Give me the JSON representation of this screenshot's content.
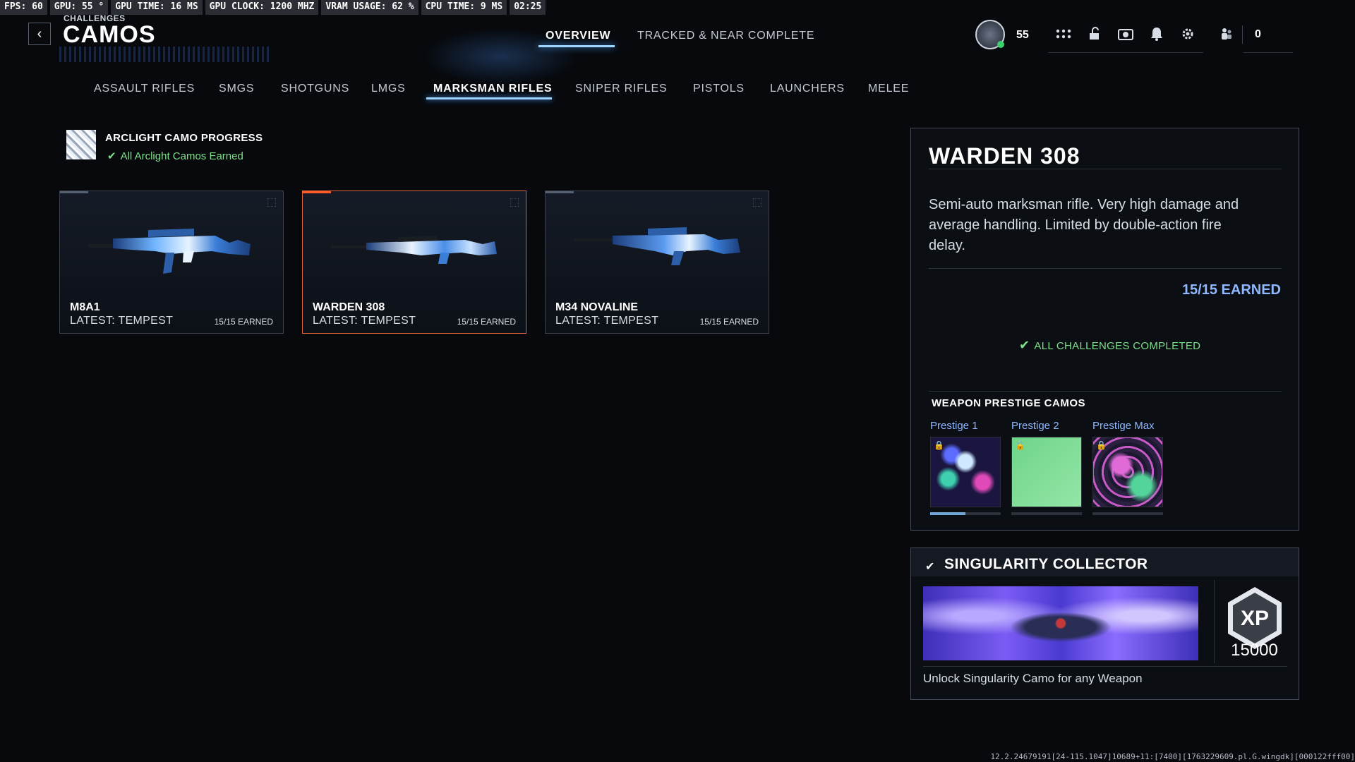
{
  "perf_overlay": [
    "FPS:  60",
    "GPU: 55 °",
    "GPU TIME: 16 MS",
    "GPU CLOCK: 1200 MHZ",
    "VRAM USAGE: 62 %",
    "CPU TIME:  9 MS",
    "02:25"
  ],
  "header": {
    "breadcrumb": "CHALLENGES",
    "title": "CAMOS",
    "tabs": [
      {
        "label": "OVERVIEW",
        "active": true
      },
      {
        "label": "TRACKED & NEAR COMPLETE",
        "active": false
      }
    ],
    "player_level": "55",
    "currency": "0",
    "icons": [
      "apps-grid-icon",
      "unlock-icon",
      "camera-icon",
      "bell-icon",
      "gear-icon",
      "friends-icon"
    ]
  },
  "categories": [
    {
      "label": "ASSAULT RIFLES",
      "active": false
    },
    {
      "label": "SMGS",
      "active": false
    },
    {
      "label": "SHOTGUNS",
      "active": false
    },
    {
      "label": "LMGS",
      "active": false
    },
    {
      "label": "MARKSMAN RIFLES",
      "active": true
    },
    {
      "label": "SNIPER RIFLES",
      "active": false
    },
    {
      "label": "PISTOLS",
      "active": false
    },
    {
      "label": "LAUNCHERS",
      "active": false
    },
    {
      "label": "MELEE",
      "active": false
    }
  ],
  "progress": {
    "title": "ARCLIGHT CAMO PROGRESS",
    "status": "All Arclight Camos Earned"
  },
  "weapons": [
    {
      "name": "M8A1",
      "latest": "LATEST: TEMPEST",
      "earned": "15/15 EARNED",
      "selected": false
    },
    {
      "name": "WARDEN 308",
      "latest": "LATEST: TEMPEST",
      "earned": "15/15 EARNED",
      "selected": true
    },
    {
      "name": "M34 NOVALINE",
      "latest": "LATEST: TEMPEST",
      "earned": "15/15 EARNED",
      "selected": false
    }
  ],
  "detail": {
    "weapon_name": "WARDEN 308",
    "description": "Semi-auto marksman rifle. Very high damage and average handling. Limited by double-action fire delay.",
    "earned": "15/15 EARNED",
    "status": "ALL CHALLENGES COMPLETED",
    "prestige_title": "WEAPON PRESTIGE CAMOS",
    "prestige": [
      {
        "label": "Prestige 1",
        "locked": true,
        "progress": 0.5
      },
      {
        "label": "Prestige 2",
        "locked": true,
        "progress": 0
      },
      {
        "label": "Prestige Max",
        "locked": true,
        "progress": 0
      }
    ]
  },
  "reward": {
    "title": "SINGULARITY COLLECTOR",
    "xp_label": "XP",
    "xp_value": "15000",
    "description": "Unlock Singularity Camo for any Weapon"
  },
  "build_string": "12.2.24679191[24-115.1047]10689+11:[7400][1763229609.pl.G.wingdk][000122fff00]",
  "colors": {
    "accent_blue": "#9fd4ff",
    "success_green": "#7fe08a",
    "selected_orange": "#e0633a",
    "earned_blue": "#8fb8ff"
  }
}
